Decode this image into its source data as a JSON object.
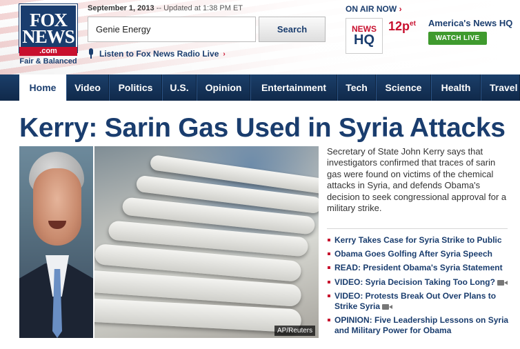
{
  "header": {
    "logo": {
      "word1": "FOX",
      "word2": "NEWS",
      "domain": ".com",
      "tagline": "Fair & Balanced"
    },
    "date": "September 1, 2013",
    "updated": "-- Updated at 1:38 PM ET",
    "search": {
      "value": "Genie Energy",
      "button_label": "Search"
    },
    "radio": {
      "label": "Listen to Fox News Radio Live",
      "arrow": "›"
    },
    "on_air": {
      "label": "ON AIR NOW",
      "arrow": "›",
      "logo_line1": "NEWS",
      "logo_line2": "HQ",
      "time": "12p",
      "time_suffix": "et",
      "show_title": "America's News HQ",
      "watch_label": "WATCH LIVE"
    }
  },
  "nav": {
    "items": [
      {
        "label": "Home",
        "active": true
      },
      {
        "label": "Video"
      },
      {
        "label": "Politics"
      },
      {
        "label": "U.S."
      },
      {
        "label": "Opinion"
      },
      {
        "label": "Entertainment"
      },
      {
        "label": "Tech"
      },
      {
        "label": "Science"
      },
      {
        "label": "Health"
      },
      {
        "label": "Travel"
      }
    ]
  },
  "story": {
    "headline": "Kerry: Sarin Gas Used in Syria Attacks",
    "photo_credit": "AP/Reuters",
    "summary": "Secretary of State John Kerry says that investigators confirmed that traces of sarin gas were found on victims of the chemical attacks in Syria, and defends Obama's decision to seek congressional approval for a military strike.",
    "related": [
      {
        "text": "Kerry Takes Case for Syria Strike to Public",
        "video": false
      },
      {
        "text": "Obama Goes Golfing After Syria Speech",
        "video": false
      },
      {
        "text": "READ: President Obama's Syria Statement",
        "video": false
      },
      {
        "text": "VIDEO: Syria Decision Taking Too Long?",
        "video": true
      },
      {
        "text": "VIDEO: Protests Break Out Over Plans to Strike Syria",
        "video": true
      },
      {
        "text": "OPINION: Five Leadership Lessons on Syria and Military Power for Obama",
        "video": false
      }
    ]
  },
  "colors": {
    "brand_blue": "#1a3d6e",
    "accent_red": "#c8102e",
    "live_green": "#3f9a2e"
  }
}
